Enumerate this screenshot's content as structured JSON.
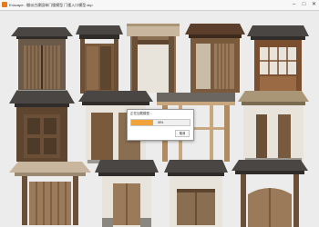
{
  "window": {
    "title": "Enscape - 徽派古建园林门楼模型 门楼入口模型.skp",
    "minimize_glyph": "–",
    "maximize_glyph": "□",
    "close_glyph": "✕"
  },
  "dialog": {
    "title": "正在加载模型…",
    "progress_label": "38%",
    "progress_fraction": 0.38,
    "cancel_label": "取消"
  },
  "colors": {
    "accent": "#f0a23b",
    "roof_dark": "#4a4643",
    "wood": "#7a5a3c",
    "plaster": "#e8e4dc"
  }
}
